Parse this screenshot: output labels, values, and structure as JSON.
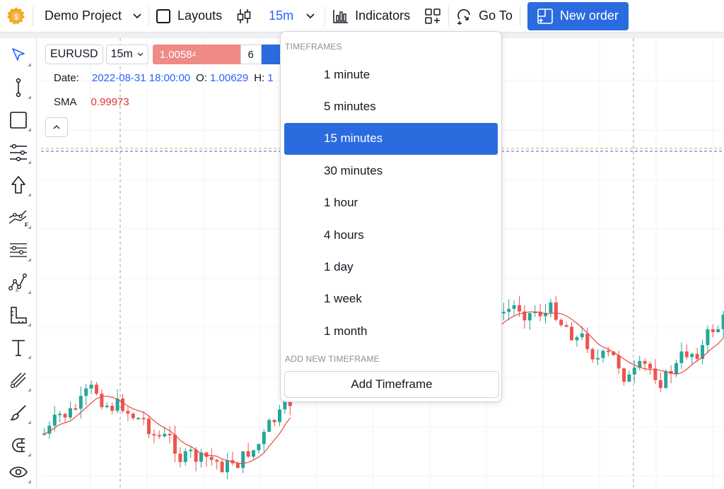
{
  "toolbar": {
    "logo_icon": "gear-coin-icon",
    "project_label": "Demo Project",
    "layouts_label": "Layouts",
    "timeframe_label": "15m",
    "indicators_label": "Indicators",
    "goto_label": "Go To",
    "new_order_label": "New order",
    "accent_color": "#2b6be0"
  },
  "legend": {
    "symbol": "EURUSD",
    "interval": "15m",
    "sell_price": "1.0058",
    "sell_price_sup": "4",
    "quantity": "6",
    "date_label": "Date:",
    "date_value": "2022-08-31 18:00:00",
    "open_label": "O:",
    "open_value": "1.00629",
    "high_label": "H:",
    "high_value": "1",
    "sma_label": "SMA",
    "sma_value": "0.99973"
  },
  "timeframe_menu": {
    "heading": "TIMEFRAMES",
    "items": [
      {
        "label": "1 minute",
        "selected": false
      },
      {
        "label": "5 minutes",
        "selected": false
      },
      {
        "label": "15 minutes",
        "selected": true
      },
      {
        "label": "30 minutes",
        "selected": false
      },
      {
        "label": "1 hour",
        "selected": false
      },
      {
        "label": "4 hours",
        "selected": false
      },
      {
        "label": "1 day",
        "selected": false
      },
      {
        "label": "1 week",
        "selected": false
      },
      {
        "label": "1 month",
        "selected": false
      }
    ],
    "add_heading": "ADD NEW TIMEFRAME",
    "add_button_label": "Add Timeframe"
  },
  "left_tools": [
    "cursor-arrow-icon",
    "trend-line-icon",
    "rectangle-icon",
    "fib-tools-icon",
    "arrow-up-icon",
    "forecast-icon",
    "gann-icon",
    "pattern-icon",
    "measure-icon",
    "text-icon",
    "brush-tools-icon",
    "paintbrush-icon",
    "magnet-icon",
    "eye-icon"
  ],
  "chart_colors": {
    "up": "#26a69a",
    "down": "#ef5350",
    "sma": "#e84a3f",
    "price_line_orange": "#f0a030",
    "price_line_blue": "#2962ff"
  }
}
